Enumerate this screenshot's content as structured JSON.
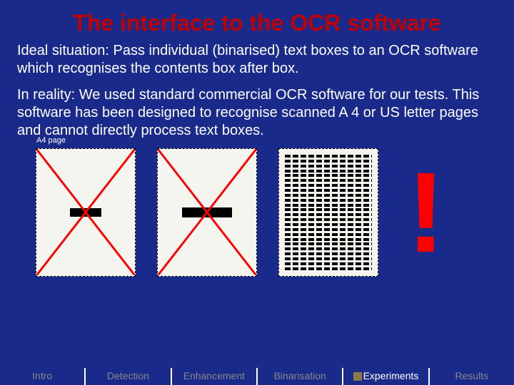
{
  "title": "The interface to the OCR software",
  "para1": "Ideal situation:\nPass individual (binarised) text boxes to an OCR software which recognises the contents box after box.",
  "para2": "In reality:\nWe used standard commercial OCR software for our tests. This software has been designed to recognise scanned A 4 or US letter pages and cannot directly process text boxes.",
  "figure": {
    "page_label": "A4 page",
    "bang": "!"
  },
  "nav": {
    "items": [
      "Intro",
      "Detection",
      "Enhancement",
      "Binarisation",
      "Experiments",
      "Results"
    ],
    "active_index": 4
  }
}
